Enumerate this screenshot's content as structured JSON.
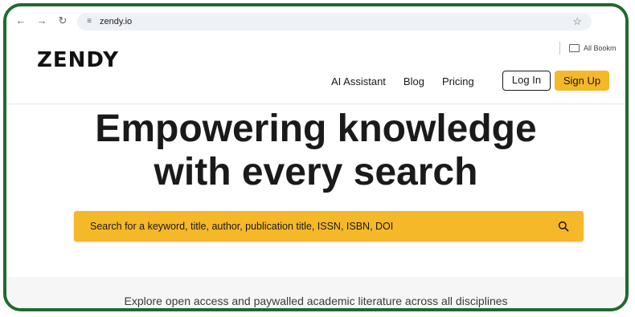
{
  "browser": {
    "url": "zendy.io",
    "bookmarks_item": "All Bookm"
  },
  "site": {
    "logo_text": "ZENDY",
    "nav": [
      {
        "label": "AI Assistant"
      },
      {
        "label": "Blog"
      },
      {
        "label": "Pricing"
      }
    ],
    "login_label": "Log In",
    "signup_label": "Sign Up",
    "accent_color": "#f4b829"
  },
  "hero": {
    "title_line1": "Empowering knowledge",
    "title_line2": "with every search",
    "search_placeholder": "Search for a keyword, title, author, publication title, ISSN, ISBN, DOI",
    "tagline": "Explore open access and paywalled academic literature across all disciplines"
  },
  "icons": {
    "back": "arrow-left-icon",
    "forward": "arrow-right-icon",
    "reload": "reload-icon",
    "site_info": "tune-icon",
    "bookmark": "star-icon",
    "folder": "folder-icon",
    "search": "search-icon"
  }
}
